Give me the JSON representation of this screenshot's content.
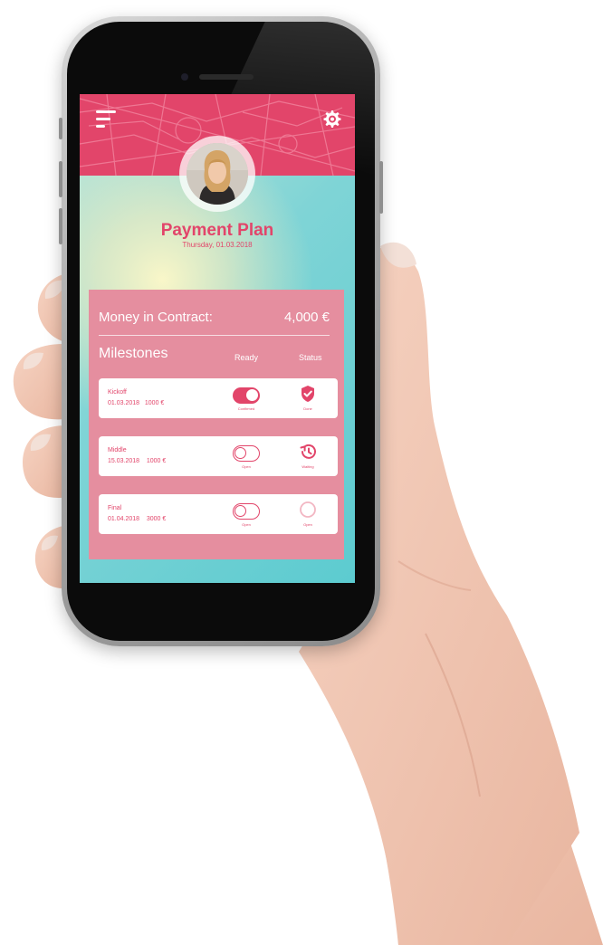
{
  "app": {
    "title": "Payment Plan",
    "date": "Thursday, 01.03.2018"
  },
  "contract": {
    "label": "Money in Contract:",
    "value": "4,000 €"
  },
  "milestones": {
    "heading": "Milestones",
    "col_ready": "Ready",
    "col_status": "Status",
    "rows": [
      {
        "name": "Kickoff",
        "date": "01.03.2018",
        "amount": "1000 €",
        "ready": "Confirmed",
        "ready_on": true,
        "status": "Done",
        "status_icon": "shield-check-icon"
      },
      {
        "name": "Middle",
        "date": "15.03.2018",
        "amount": "1000 €",
        "ready": "Open",
        "ready_on": false,
        "status": "Waiting",
        "status_icon": "history-clock-icon"
      },
      {
        "name": "Final",
        "date": "01.04.2018",
        "amount": "3000 €",
        "ready": "Open",
        "ready_on": false,
        "status": "Open",
        "status_icon": "open-circle-icon"
      }
    ]
  },
  "icons": {
    "menu": "menu-icon",
    "settings": "gear-icon"
  },
  "colors": {
    "accent": "#e2456a",
    "card": "#e58e9f",
    "row": "#ffffff"
  }
}
